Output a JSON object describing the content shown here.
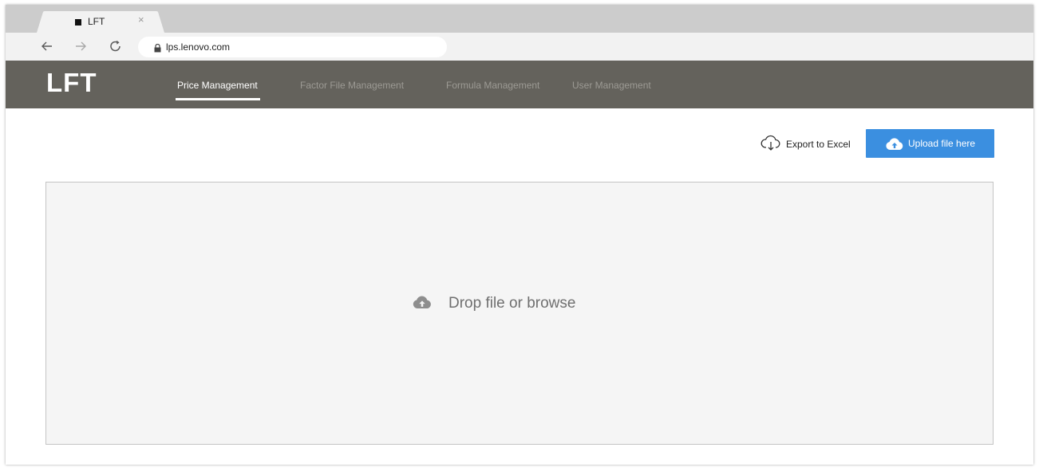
{
  "browser": {
    "tab": {
      "title": "LFT",
      "close_glyph": "×"
    },
    "url": "lps.lenovo.com",
    "icons": [
      "back-icon",
      "forward-icon",
      "reload-icon",
      "lock-icon"
    ]
  },
  "header": {
    "logo": "LFT",
    "nav": [
      {
        "label": "Price Management",
        "active": true
      },
      {
        "label": "Factor File Management",
        "active": false
      },
      {
        "label": "Formula Management",
        "active": false
      },
      {
        "label": "User Management",
        "active": false
      }
    ]
  },
  "actions": {
    "export_label": "Export to Excel",
    "upload_label": "Upload file here"
  },
  "dropzone": {
    "label": "Drop file or browse"
  },
  "colors": {
    "header_bg": "#64625c",
    "accent": "#3b8fe0",
    "nav_inactive": "#9c9a94",
    "dropzone_bg": "#f5f5f5"
  }
}
